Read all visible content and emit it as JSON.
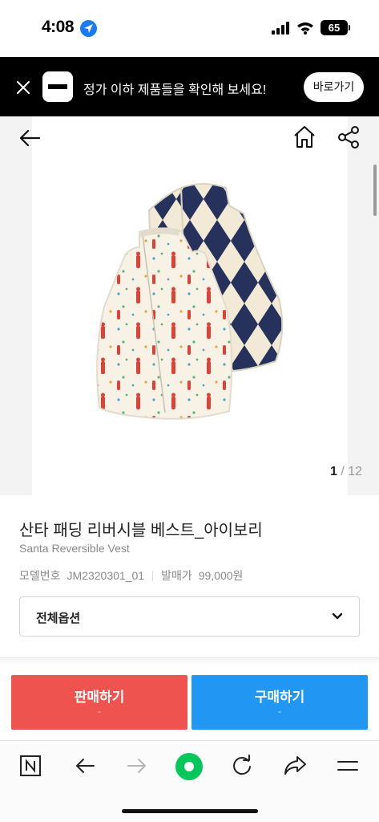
{
  "status_bar": {
    "time": "4:08",
    "battery": "65",
    "icons": [
      "location-arrow-icon",
      "signal-bars-icon",
      "wifi-icon",
      "battery-icon"
    ]
  },
  "promo_banner": {
    "text": "정가 이하 제품들을 확인해 보세요!",
    "button_label": "바로가기",
    "icons": [
      "close-icon",
      "app-logo-icon"
    ]
  },
  "image_viewer": {
    "current_page": "1",
    "separator": " / ",
    "total_pages": "12",
    "icons": [
      "back-arrow-icon",
      "home-icon",
      "share-icon"
    ],
    "image_subject": "reversible vest: cream padded side with Santa print, navy argyle fleece side"
  },
  "product": {
    "title": "산타 패딩 리버시블 베스트_아이보리",
    "subtitle": "Santa Reversible Vest",
    "model_label": "모델번호",
    "model_value": "JM2320301_01",
    "price_label": "발매가",
    "price_value": "99,000원"
  },
  "options": {
    "selected": "전체옵션",
    "icon": "chevron-down-icon"
  },
  "actions": {
    "sell_label": "판매하기",
    "sell_sub": "-",
    "buy_label": "구매하기",
    "buy_sub": "-",
    "sell_color": "#ef5350",
    "buy_color": "#2196f3"
  },
  "browser_toolbar": {
    "icons": [
      "n-logo-icon",
      "back-icon",
      "forward-icon",
      "green-dot-icon",
      "refresh-icon",
      "share-arrow-icon",
      "menu-icon"
    ],
    "accent_color": "#03c75a"
  }
}
